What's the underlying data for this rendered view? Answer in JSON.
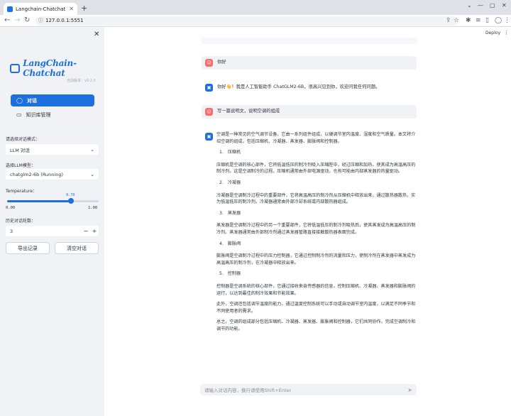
{
  "browser": {
    "tab_title": "Langchain-Chatchat WebUI",
    "url": "127.0.0.1:5551"
  },
  "sidebar": {
    "logo_text": "LangChain-Chatchat",
    "version": "当前版本：v0.2.5",
    "menu": [
      {
        "label": "对话",
        "active": true
      },
      {
        "label": "知识库管理",
        "active": false
      }
    ],
    "mode_label": "请选择对话模式：",
    "mode_value": "LLM 对话",
    "model_label": "选择LLM模型：",
    "model_value": "chatglm2-6b (Running)",
    "temperature_label": "Temperature：",
    "temperature_value": "0.70",
    "temperature_fraction": 0.7,
    "temperature_min": "0.00",
    "temperature_max": "1.00",
    "history_label": "历史对话轮数：",
    "history_value": "3",
    "export_button": "导出记录",
    "clear_button": "清空对话"
  },
  "header": {
    "deploy": "Deploy"
  },
  "messages": [
    {
      "role": "user",
      "text": "你好"
    },
    {
      "role": "assistant",
      "text": "你好👋！我是人工智能助手 ChatGLM2-6B，很高兴见到你，欢迎问我任何问题。"
    },
    {
      "role": "user",
      "text": "写一篇说明文，说明空调的组成"
    }
  ],
  "answer": {
    "intro": "空调是一种常见的空气调节设备，它由一系列组件组成，以便调节室内温度、湿度和空气质量。本文将介绍空调的组成，包括压缩机、冷凝器、蒸发器、膨胀阀和控制器。",
    "sections": [
      {
        "num": "1.",
        "title": "压缩机",
        "body": "压缩机是空调的核心部件，它将低温低压的制冷剂吸入压缩腔中，经过压缩和加热，使其成为高温高压的制冷剂。这是空调制冷的过程。压缩机通常由外部电源驱动，也有可能由内部蒸发器的热量驱动。"
      },
      {
        "num": "2.",
        "title": "冷凝器",
        "body": "冷凝器是空调制冷过程中的重要部件，它将高温高压的制冷剂从压缩机中释放出来，通过散热器散热，实为低温低压的制冷剂。冷凝器通常由外部冷却系统或内部散热器组成。"
      },
      {
        "num": "3.",
        "title": "蒸发器",
        "body": "蒸发器是空调制冷过程中的另一个重要部件，它将低温低压的制冷剂吸热后，使其蒸发成为高温高压的制冷剂。蒸发器通常由外部制冷剂通过蒸发器管路直接接触散热器表面完成。"
      },
      {
        "num": "4.",
        "title": "膨胀阀",
        "body": "膨胀阀是空调制冷过程中的压力控制器，它通过控制制冷剂的流量和压力，使制冷剂在蒸发器中蒸发成为高温高压的制冷剂，在冷凝器中释放出来。"
      },
      {
        "num": "5.",
        "title": "控制器",
        "body": "控制器是空调系统的核心部件，它通过接收来自传感器的信息，控制压缩机、冷凝器、蒸发器和膨胀阀的运行，以达到最佳的制冷效果和节能效果。"
      }
    ],
    "outro1": "此外，空调还包括调节温度的能力，通过温度控制系统可以手动或自动调节室内温度，以满足不同季节和不同使用者的需求。",
    "outro2": "总之，空调的组成部分包括压缩机、冷凝器、蒸发器、膨胀阀和控制器，它们共同协作，完成空调制冷和调节的功能。"
  },
  "input": {
    "placeholder": "请输入对话内容，换行请使用Shift+Enter"
  },
  "colors": {
    "accent": "#1c6fdc",
    "sidebar_bg": "#f0f2f6",
    "user_avatar": "#ff6b6b"
  }
}
